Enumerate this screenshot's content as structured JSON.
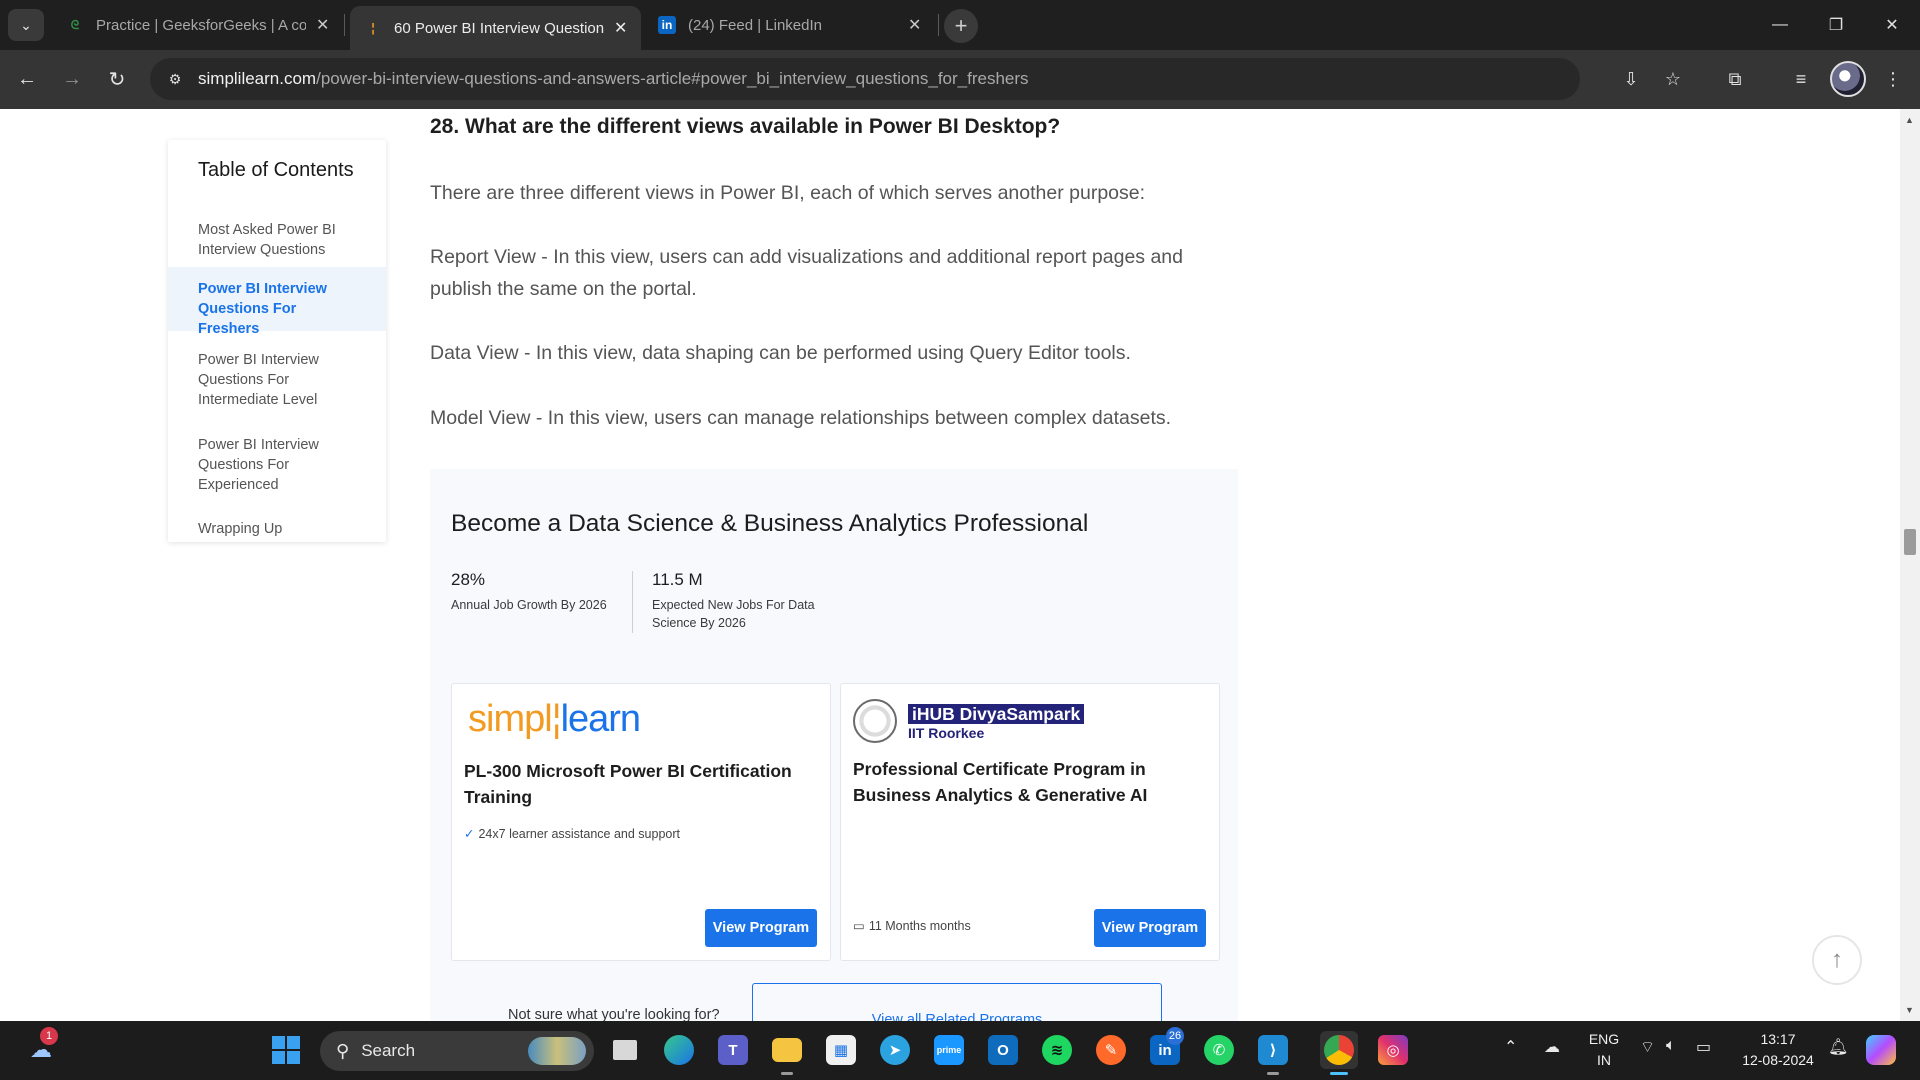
{
  "browser": {
    "tabs": [
      {
        "title": "Practice | GeeksforGeeks | A cor",
        "icon": "geeksforgeeks-icon",
        "active": false
      },
      {
        "title": "60 Power BI Interview Question",
        "icon": "simplilearn-icon",
        "active": true
      },
      {
        "title": "(24) Feed | LinkedIn",
        "icon": "linkedin-icon",
        "active": false
      }
    ],
    "url_host": "simplilearn.com",
    "url_path": "/power-bi-interview-questions-and-answers-article#power_bi_interview_questions_for_freshers"
  },
  "toc": {
    "title": "Table of Contents",
    "items": [
      {
        "label": "Most Asked Power BI Interview Questions",
        "active": false
      },
      {
        "label": "Power BI Interview Questions For Freshers",
        "active": true
      },
      {
        "label": "Power BI Interview Questions For Intermediate Level",
        "active": false
      },
      {
        "label": "Power BI Interview Questions For Experienced",
        "active": false
      },
      {
        "label": "Wrapping Up",
        "active": false
      }
    ]
  },
  "article": {
    "heading": "28. What are the different views available in Power BI Desktop?",
    "paragraphs": [
      "There are three different views in Power BI, each of which serves another purpose:",
      "Report View - In this view, users can add visualizations and additional report pages and publish the same on the portal.",
      "Data View - In this view, data shaping can be performed using Query Editor tools.",
      "Model View - In this view, users can manage relationships between complex datasets."
    ]
  },
  "promo": {
    "title": "Become a Data Science & Business Analytics Professional",
    "stats": [
      {
        "value": "28%",
        "label": "Annual Job Growth By 2026"
      },
      {
        "value": "11.5 M",
        "label": "Expected New Jobs For Data Science By 2026"
      }
    ],
    "cards": [
      {
        "logo": "simplilearn",
        "title": "PL-300 Microsoft Power BI Certification Training",
        "feature": "24x7 learner assistance and support",
        "button": "View Program"
      },
      {
        "logo": "iHUB DivyaSampark",
        "logo_sub": "IIT Roorkee",
        "title": "Professional Certificate Program in Business Analytics & Generative AI",
        "duration": "11 Months months",
        "button": "View Program"
      }
    ],
    "related_text": "Not sure what you're looking for?",
    "related_button": "View all Related Programs"
  },
  "taskbar": {
    "search_label": "Search",
    "weather_badge": "1",
    "linkedin_badge": "26",
    "language": "ENG",
    "region": "IN",
    "time": "13:17",
    "date": "12-08-2024"
  },
  "colors": {
    "accent": "#1a73e8",
    "simplilearn_orange": "#f29b22",
    "ihub_navy": "#24237a"
  }
}
